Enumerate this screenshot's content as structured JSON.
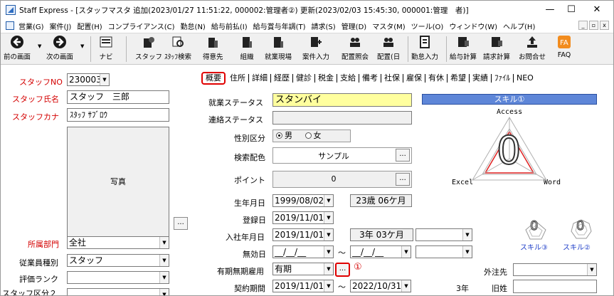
{
  "window": {
    "title": "Staff Express - [スタッフマスタ 追加(2023/01/27 11:51:22, 000002:管理者②) 更新(2023/02/03 15:45:30, 000001:管理　者)]",
    "minimize": "—",
    "maximize": "☐",
    "close": "✕"
  },
  "menu": [
    "営業(G)",
    "案件(J)",
    "配置(H)",
    "コンプライアンス(C)",
    "勤怠(N)",
    "給与前払(I)",
    "給与賞与年調(T)",
    "請求(S)",
    "管理(D)",
    "マスタ(M)",
    "ツール(O)",
    "ウィンドウ(W)",
    "ヘルプ(H)"
  ],
  "mdi": [
    "_",
    "▫",
    "x"
  ],
  "toolbar": {
    "prev": "前の画面",
    "next": "次の画面",
    "navi": "ナビ",
    "items": [
      "スタッフ",
      "ｽﾀｯﾌ検索",
      "得意先",
      "組織",
      "就業現場",
      "案件入力",
      "配置照会",
      "配置(日",
      "勤怠入力",
      "給与計算",
      "請求計算",
      "お問合せ",
      "FAQ"
    ]
  },
  "left": {
    "staff_no_label": "スタッフNO",
    "staff_no": "230003",
    "name_label": "スタッフ氏名",
    "name": "スタッフ　三郎",
    "kana_label": "スタッフカナ",
    "kana": "ｽﾀｯﾌ ｻﾌﾞﾛｳ",
    "photo_label": "写真",
    "photo_btn": "...",
    "dept_label": "所属部門",
    "dept": "全社",
    "emp_type_label": "従業員種別",
    "emp_type": "スタッフ",
    "rank_label": "評価ランク",
    "rank": "",
    "staff_class_label": "スタッフ区分２"
  },
  "tabs": [
    "概要",
    "住所",
    "詳細",
    "経歴",
    "健診",
    "税金",
    "支給",
    "備考",
    "社保",
    "雇保",
    "有休",
    "希望",
    "実績",
    "ﾌｧｲﾙ",
    "NEO"
  ],
  "form": {
    "work_status_label": "就業ステータス",
    "work_status": "スタンバイ",
    "contact_status_label": "連絡ステータス",
    "contact_status": "",
    "gender_label": "性別区分",
    "gender_male": "男",
    "gender_female": "女",
    "color_label": "検索配色",
    "color_value": "サンプル",
    "point_label": "ポイント",
    "point_value": "0",
    "birth_label": "生年月日",
    "birth": "1999/08/02",
    "age": "23歳 06ケ月",
    "reg_label": "登録日",
    "reg": "2019/11/01",
    "hire_label": "入社年月日",
    "hire": "2019/11/01",
    "tenure": "3年 03ケ月",
    "invalid_label": "無効日",
    "invalid_from": "__/__/__",
    "invalid_to": "__/__/__",
    "tilde": "～",
    "term_label": "有期無期雇用",
    "term": "有期",
    "term_btn": "...",
    "term_marker": "①",
    "period_label": "契約期間",
    "period_from": "2019/11/01",
    "period_to": "2022/10/31",
    "period_years": "3年",
    "outsource_label": "外注先",
    "old_name_label": "旧姓",
    "ellipsis": "..."
  },
  "skill": {
    "title": "スキル①",
    "access": "Access",
    "excel": "Excel",
    "word": "Word",
    "score": "0",
    "small_score_3": "0",
    "small_score_2": "0",
    "skill3": "スキル③",
    "skill2": "スキル②"
  },
  "colors": {
    "required_label": "#d40000",
    "work_status_bg": "#ffff9e",
    "skill_header": "#5e86d8",
    "radar_line": "#e02020"
  }
}
